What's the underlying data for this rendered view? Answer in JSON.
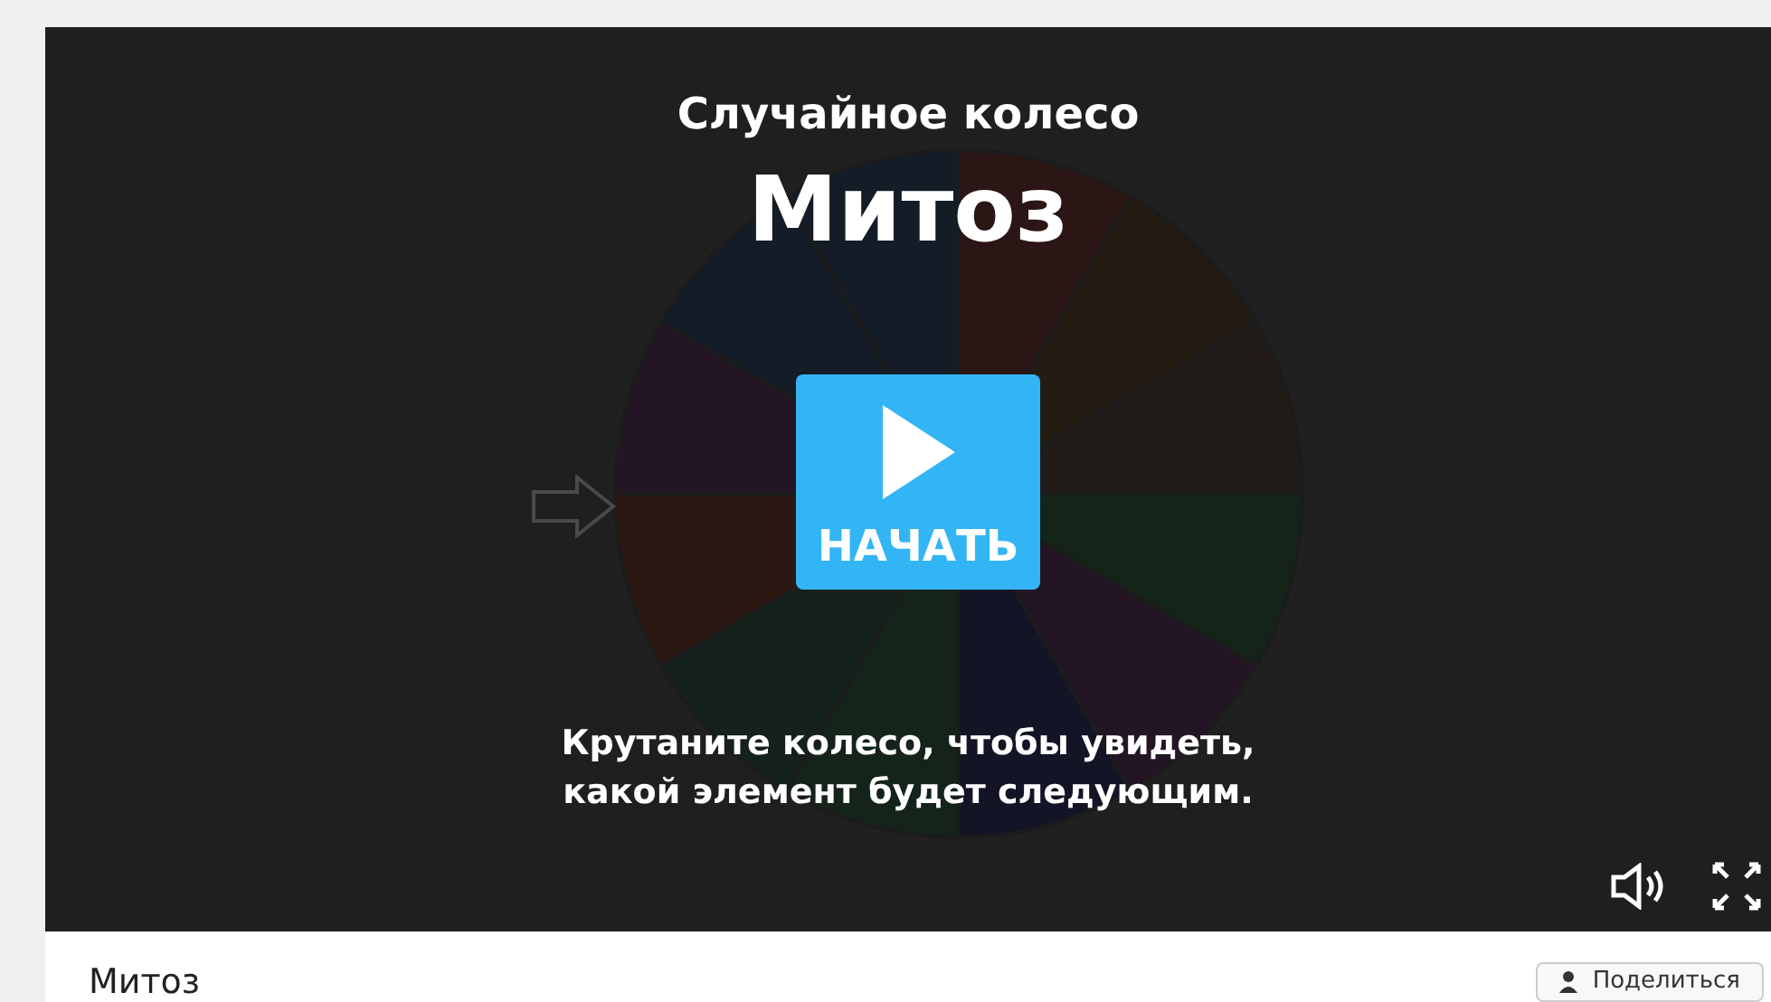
{
  "game": {
    "subtitle": "Случайное колесо",
    "title": "Митоз",
    "start_button": "НАЧАТЬ",
    "hint_lines": [
      "Крутаните колесо, чтобы увидеть,",
      "какой элемент будет следующим."
    ]
  },
  "footer": {
    "title": "Митоз",
    "share_button": "Поделиться"
  }
}
